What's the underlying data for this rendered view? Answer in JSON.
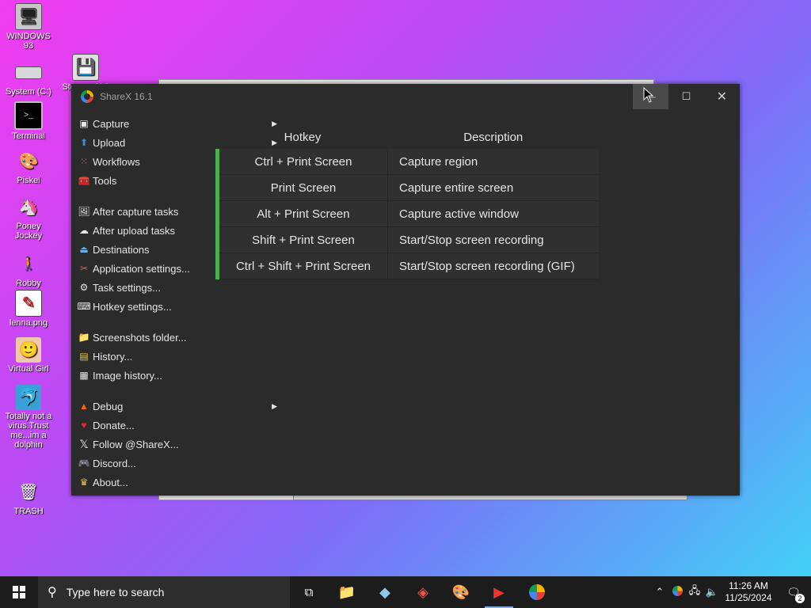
{
  "desktop": {
    "icons": [
      {
        "label": "WINDOWS 93",
        "icon": "computer-icon"
      },
      {
        "label": "System (C:)",
        "icon": "drive-icon"
      },
      {
        "label": "Storage (A:)",
        "icon": "floppy-icon"
      },
      {
        "label": "Terminal",
        "icon": "terminal-icon"
      },
      {
        "label": "Piskel",
        "icon": "palette-icon"
      },
      {
        "label": "Poney Jockey",
        "icon": "pony-icon"
      },
      {
        "label": "Robby",
        "icon": "stickman-icon"
      },
      {
        "label": "lenna.png",
        "icon": "image-icon"
      },
      {
        "label": "Virtual Girl",
        "icon": "face-icon"
      },
      {
        "label": "Totally not a virus.Trust me...im a dolphin",
        "icon": "dolphin-icon"
      },
      {
        "label": "TRASH",
        "icon": "trash-icon"
      }
    ]
  },
  "window": {
    "title": "ShareX 16.1",
    "minimize": "—",
    "maximize": "☐",
    "close": "✕"
  },
  "menu": {
    "items": [
      {
        "label": "Capture",
        "icon": "capture-icon",
        "submenu": true
      },
      {
        "label": "Upload",
        "icon": "upload-icon",
        "submenu": true
      },
      {
        "label": "Workflows",
        "icon": "workflows-icon",
        "submenu": true
      },
      {
        "label": "Tools",
        "icon": "tools-icon",
        "submenu": true
      },
      {
        "label": "After capture tasks",
        "icon": "after-capture-icon",
        "submenu": true
      },
      {
        "label": "After upload tasks",
        "icon": "cloud-upload-icon",
        "submenu": true
      },
      {
        "label": "Destinations",
        "icon": "destinations-icon",
        "submenu": true
      },
      {
        "label": "Application settings...",
        "icon": "wrench-icon",
        "submenu": false
      },
      {
        "label": "Task settings...",
        "icon": "gear-icon",
        "submenu": false
      },
      {
        "label": "Hotkey settings...",
        "icon": "keyboard-icon",
        "submenu": false
      },
      {
        "label": "Screenshots folder...",
        "icon": "folder-icon",
        "submenu": false
      },
      {
        "label": "History...",
        "icon": "history-icon",
        "submenu": false
      },
      {
        "label": "Image history...",
        "icon": "image-history-icon",
        "submenu": false
      },
      {
        "label": "Debug",
        "icon": "debug-icon",
        "submenu": true
      },
      {
        "label": "Donate...",
        "icon": "heart-icon",
        "submenu": false
      },
      {
        "label": "Follow @ShareX...",
        "icon": "x-logo-icon",
        "submenu": false
      },
      {
        "label": "Discord...",
        "icon": "discord-icon",
        "submenu": false
      },
      {
        "label": "About...",
        "icon": "crown-icon",
        "submenu": false
      }
    ]
  },
  "hotkeys": {
    "headers": {
      "hotkey": "Hotkey",
      "description": "Description"
    },
    "rows": [
      {
        "hotkey": "Ctrl + Print Screen",
        "description": "Capture region"
      },
      {
        "hotkey": "Print Screen",
        "description": "Capture entire screen"
      },
      {
        "hotkey": "Alt + Print Screen",
        "description": "Capture active window"
      },
      {
        "hotkey": "Shift + Print Screen",
        "description": "Start/Stop screen recording"
      },
      {
        "hotkey": "Ctrl + Shift + Print Screen",
        "description": "Start/Stop screen recording (GIF)"
      }
    ],
    "status_color": "#4caf50"
  },
  "taskbar": {
    "search_placeholder": "Type here to search",
    "time": "11:26 AM",
    "date": "11/25/2024",
    "notification_count": "2"
  }
}
